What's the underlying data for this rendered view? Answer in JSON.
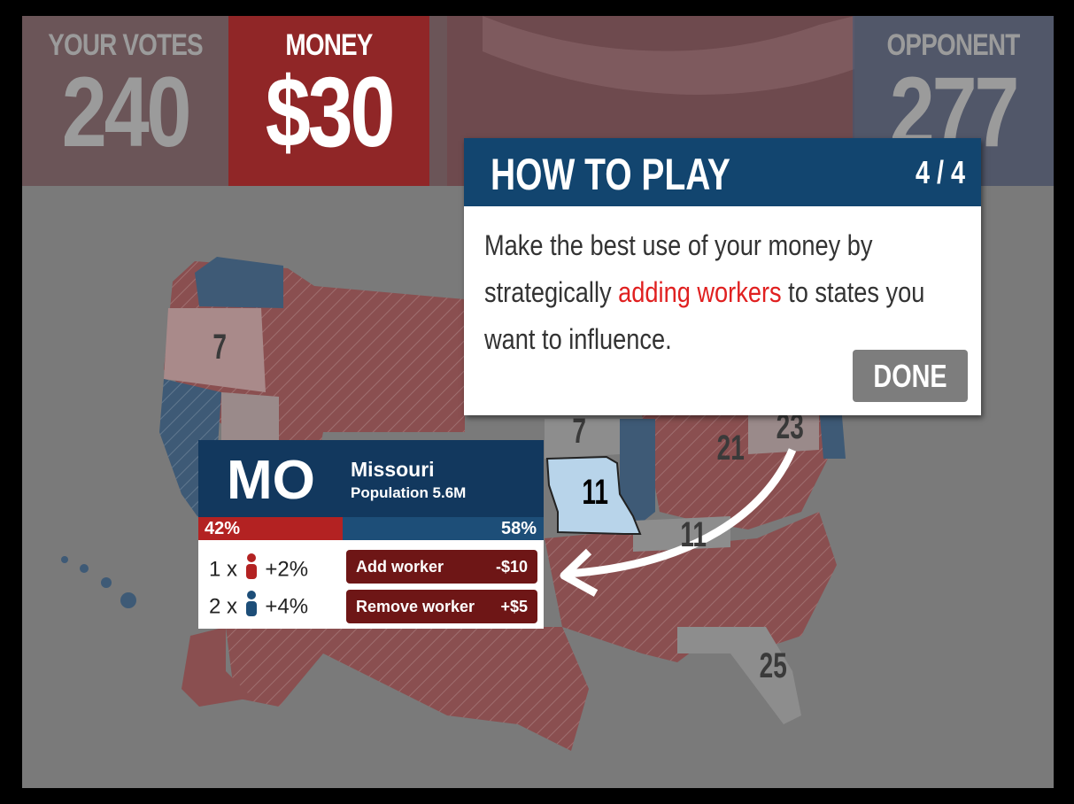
{
  "scoreboard": {
    "your_votes_label": "YOUR VOTES",
    "your_votes_value": "240",
    "money_label": "MONEY",
    "money_value": "$30",
    "opponent_label": "OPPONENT",
    "opponent_value": "277"
  },
  "howto": {
    "title": "HOW TO PLAY",
    "page": "4 / 4",
    "text_before": "Make the best use of your money by strategically ",
    "text_highlight": "adding workers",
    "text_after": " to states you want to influence.",
    "done_label": "DONE"
  },
  "state_panel": {
    "abbr": "MO",
    "name": "Missouri",
    "population": "Population 5.6M",
    "red_pct": "42%",
    "blue_pct": "58%",
    "red_workers_count": "1 x",
    "red_workers_effect": "+2%",
    "blue_workers_count": "2 x",
    "blue_workers_effect": "+4%",
    "add_worker_label": "Add worker",
    "add_worker_price": "-$10",
    "remove_worker_label": "Remove worker",
    "remove_worker_price": "+$5"
  },
  "map_labels": {
    "oregon_votes": "7",
    "missouri_votes": "11",
    "iowa_votes": "7",
    "ohio_votes": "21",
    "pennsylvania_votes": "23",
    "tennessee_votes": "11",
    "florida_votes": "25"
  },
  "colors": {
    "red": "#b32222",
    "blue": "#1d4e78",
    "navy": "#12456f",
    "highlight": "#e02020"
  }
}
